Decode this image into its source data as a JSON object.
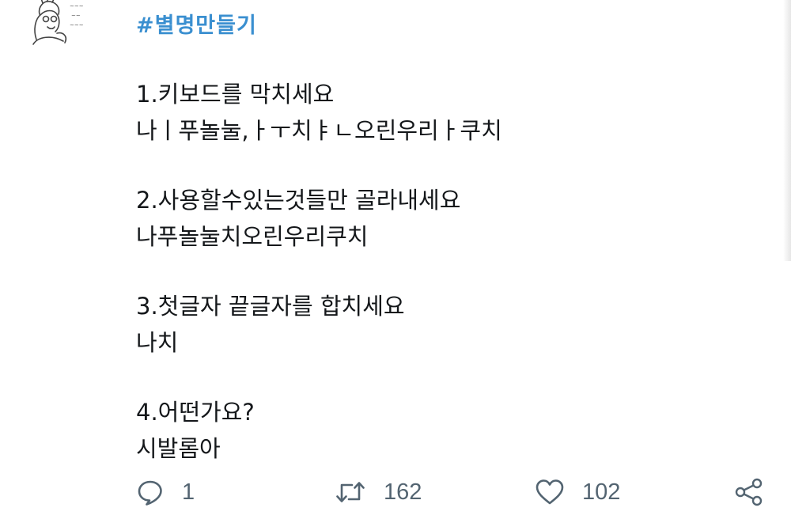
{
  "tweet": {
    "hashtag": "#별명만들기",
    "lines": [
      "1.키보드를 막치세요",
      "나ㅣ푸놀눌,ㅏㅜ치ㅑㄴ오린우리ㅏ쿠치",
      "2.사용할수있는것들만 골라내세요",
      "나푸놀눌치오린우리쿠치",
      "3.첫글자 끝글자를 합치세요",
      "나치",
      "4.어떤가요?",
      "시발롬아"
    ]
  },
  "actions": {
    "reply_icon": "reply-icon",
    "reply_count": "1",
    "retweet_icon": "retweet-icon",
    "retweet_count": "162",
    "like_icon": "heart-icon",
    "like_count": "102",
    "share_icon": "share-icon"
  },
  "colors": {
    "hashtag": "#3a8fd0",
    "text": "#14171a",
    "icon": "#536471"
  }
}
